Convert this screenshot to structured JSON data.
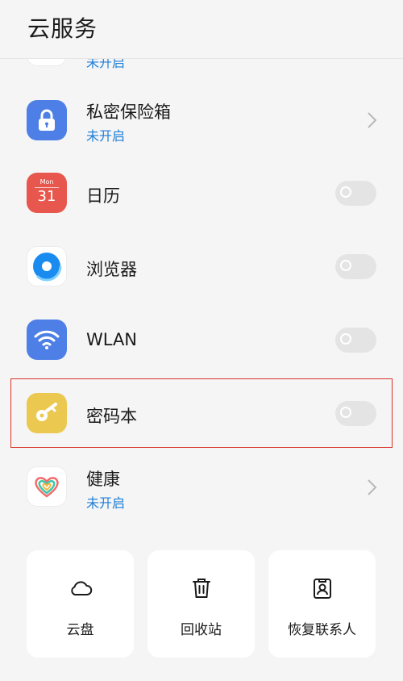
{
  "header": {
    "title": "云服务"
  },
  "list": {
    "partial_item_status": "未开启",
    "items": [
      {
        "label": "私密保险箱",
        "status": "未开启",
        "icon": "lock-icon",
        "control": "chevron"
      },
      {
        "label": "日历",
        "icon_month": "Mon",
        "icon_day": "31",
        "icon": "calendar-icon",
        "control": "toggle",
        "on": false
      },
      {
        "label": "浏览器",
        "icon": "browser-icon",
        "control": "toggle",
        "on": false
      },
      {
        "label": "WLAN",
        "icon": "wifi-icon",
        "control": "toggle",
        "on": false
      },
      {
        "label": "密码本",
        "icon": "key-icon",
        "control": "toggle",
        "on": false
      },
      {
        "label": "健康",
        "status": "未开启",
        "icon": "health-heart-icon",
        "control": "chevron"
      }
    ]
  },
  "cards": [
    {
      "label": "云盘",
      "icon": "cloud-icon"
    },
    {
      "label": "回收站",
      "icon": "trash-icon"
    },
    {
      "label": "恢复联系人",
      "icon": "contact-badge-icon"
    }
  ],
  "colors": {
    "status_blue": "#1f7fd6",
    "lock_bg": "#4d7fe6",
    "calendar_bg": "#e8574d",
    "wifi_bg": "#4d7fe6",
    "key_bg": "#ebc950",
    "highlight": "#d9342b"
  }
}
